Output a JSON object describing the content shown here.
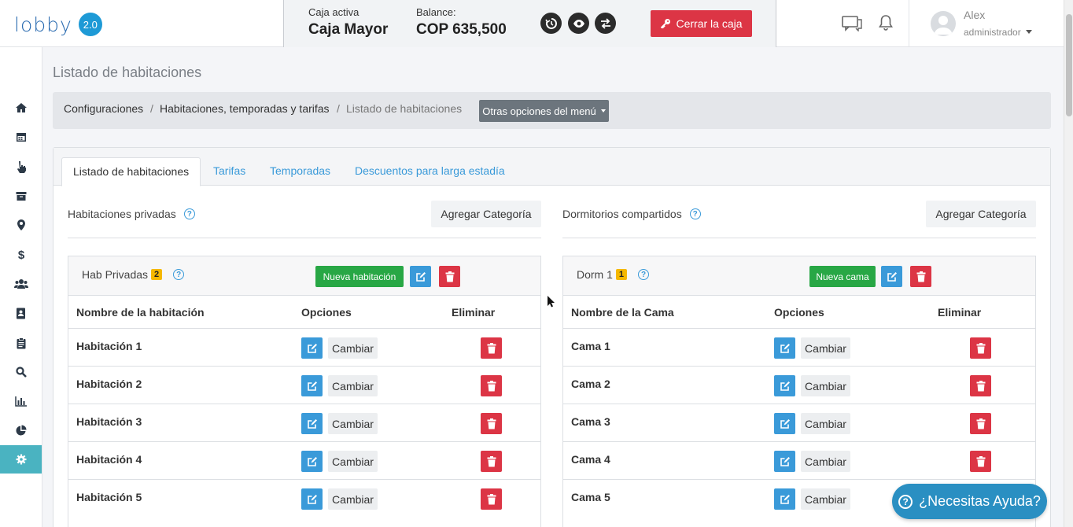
{
  "app": {
    "logo_text": "lobby",
    "version_badge": "2.0"
  },
  "cashbox": {
    "active_label": "Caja activa",
    "active_value": "Caja Mayor",
    "balance_label": "Balance:",
    "balance_value": "COP 635,500",
    "close_button": "Cerrar la caja"
  },
  "user": {
    "name": "Alex",
    "role": "administrador"
  },
  "page": {
    "title": "Listado de habitaciones",
    "breadcrumb": [
      "Configuraciones",
      "Habitaciones, temporadas y tarifas",
      "Listado de habitaciones"
    ],
    "menu_dropdown": "Otras opciones del menú"
  },
  "tabs": [
    "Listado de habitaciones",
    "Tarifas",
    "Temporadas",
    "Descuentos para larga estadía"
  ],
  "private": {
    "heading": "Habitaciones privadas",
    "add_category": "Agregar Categoría",
    "panel_title": "Hab Privadas",
    "panel_count": "2",
    "new_button": "Nueva habitación",
    "columns": [
      "Nombre de la habitación",
      "Opciones",
      "Eliminar"
    ],
    "rows": [
      "Habitación 1",
      "Habitación 2",
      "Habitación 3",
      "Habitación 4",
      "Habitación 5"
    ],
    "change_label": "Cambiar"
  },
  "shared": {
    "heading": "Dormitorios compartidos",
    "add_category": "Agregar Categoría",
    "panel_title": "Dorm 1",
    "panel_count": "1",
    "new_button": "Nueva cama",
    "columns": [
      "Nombre de la Cama",
      "Opciones",
      "Eliminar"
    ],
    "rows": [
      "Cama 1",
      "Cama 2",
      "Cama 3",
      "Cama 4",
      "Cama 5"
    ],
    "change_label": "Cambiar"
  },
  "help_button": "¿Necesitas Ayuda?",
  "colors": {
    "accent": "#3a9ad9",
    "danger": "#dc3545",
    "success": "#28a745",
    "sidebar_active": "#4ab3c1"
  }
}
